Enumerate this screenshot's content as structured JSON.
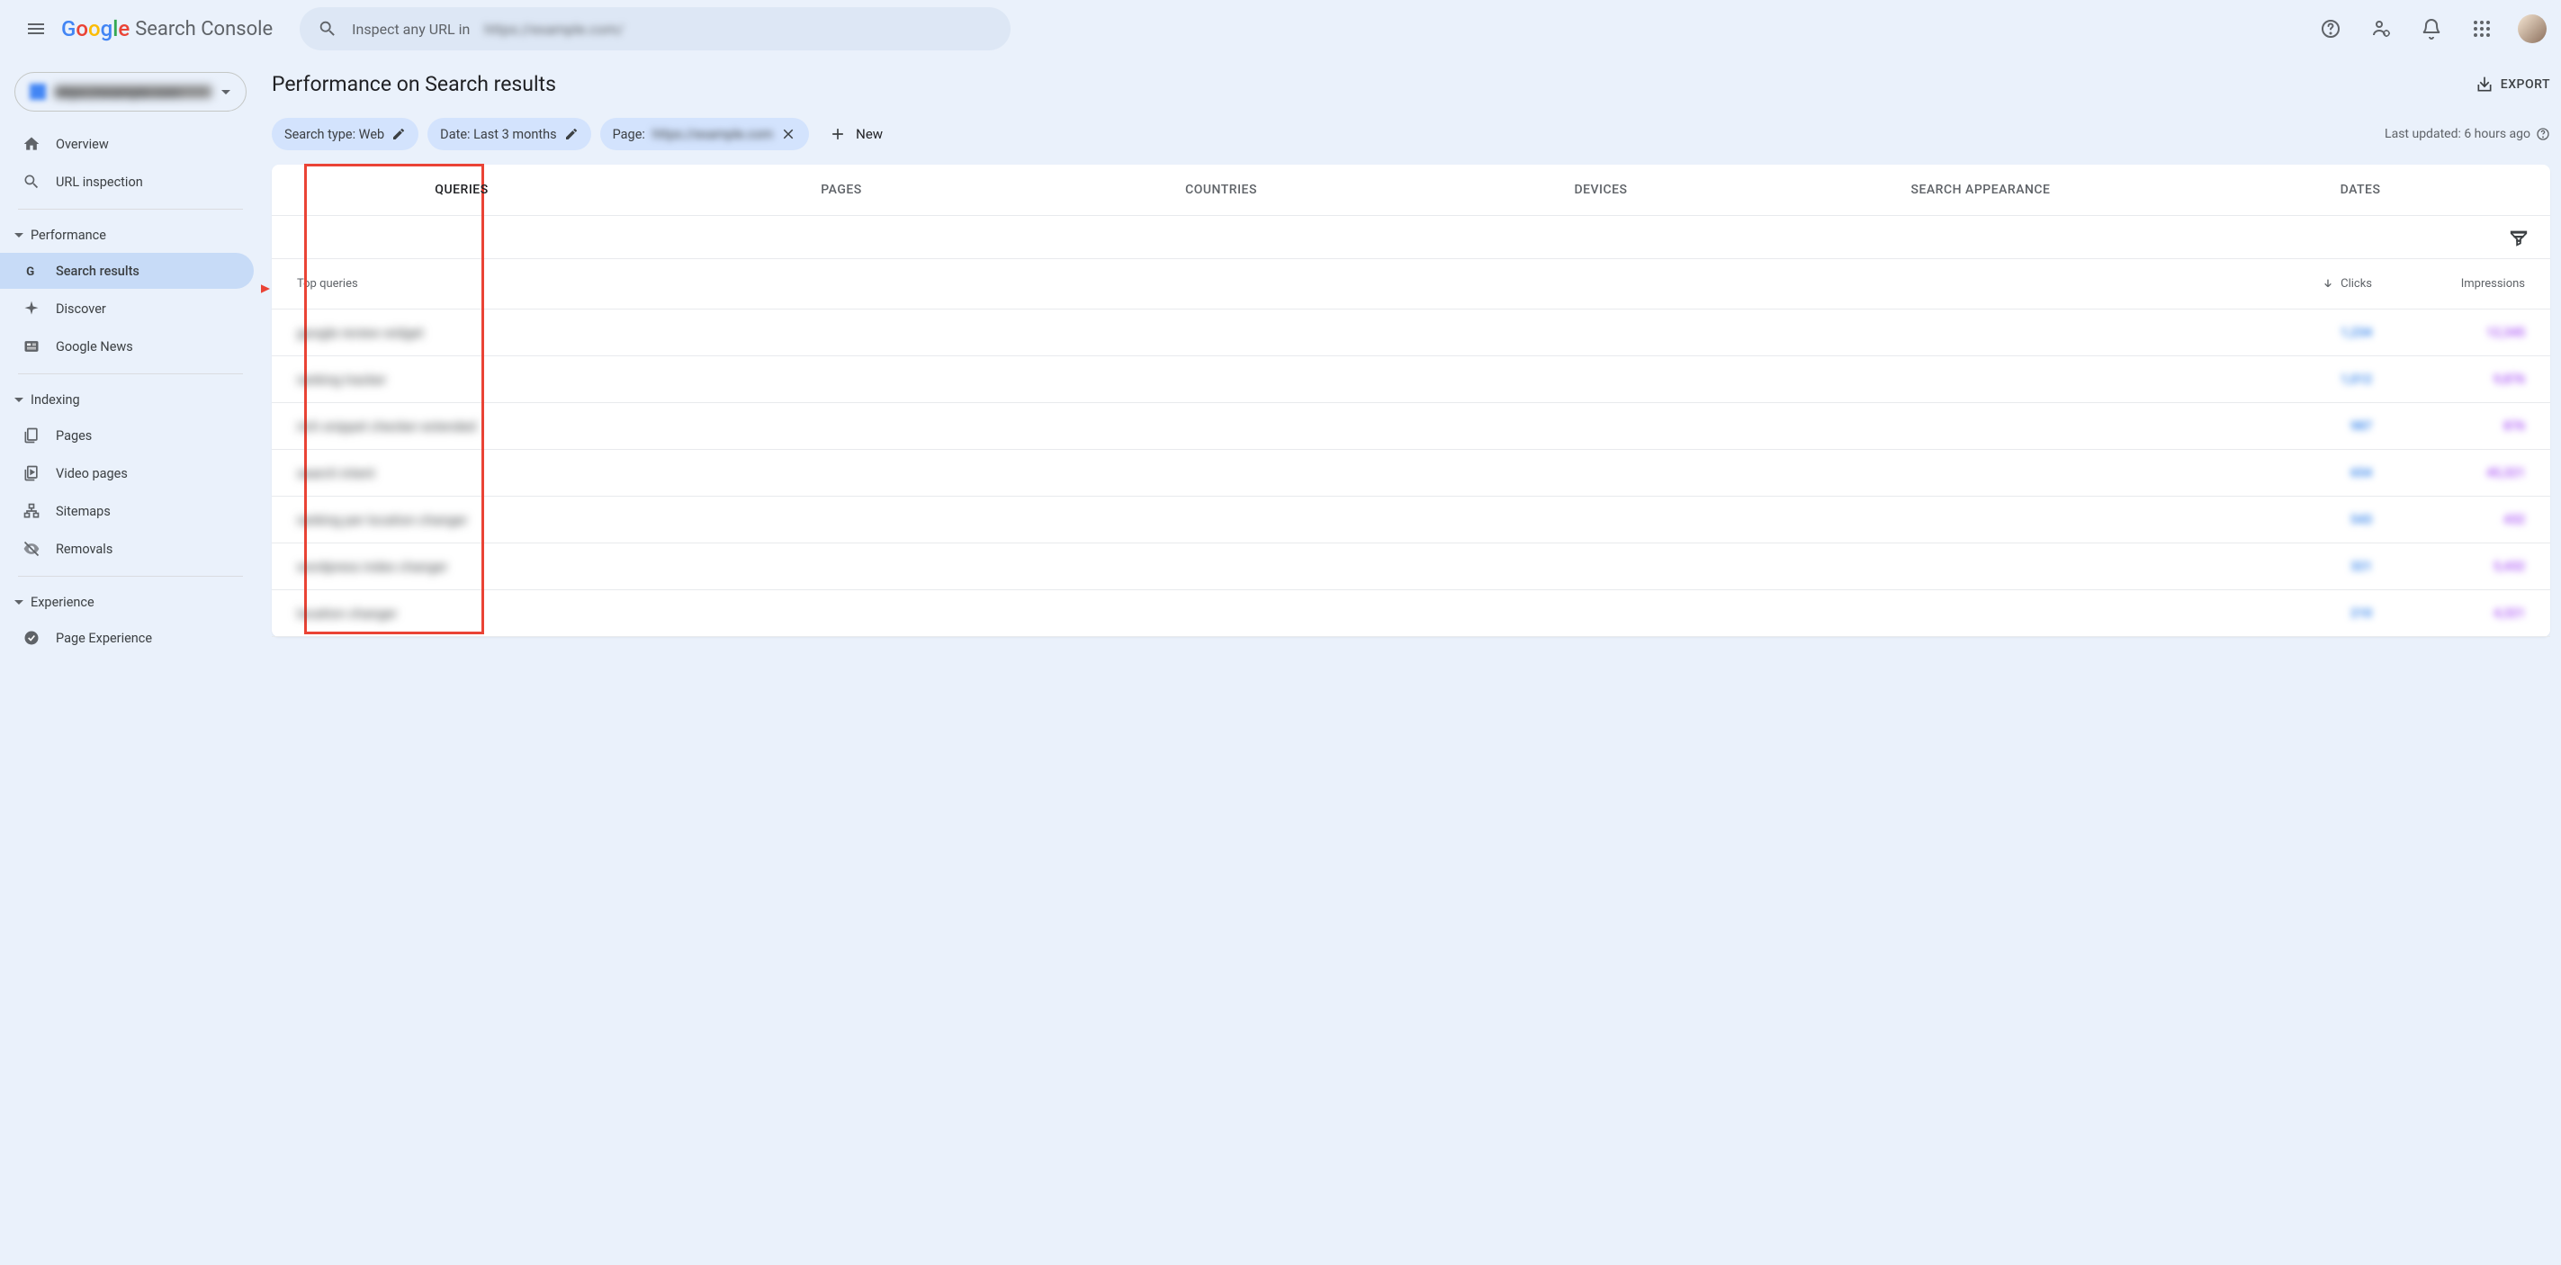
{
  "header": {
    "logo_suffix": "Search Console",
    "search_placeholder": "Inspect any URL in",
    "search_domain": "https://example.com/"
  },
  "property": {
    "name": "https://example.com"
  },
  "nav": {
    "overview": "Overview",
    "url_inspection": "URL inspection",
    "performance_section": "Performance",
    "search_results": "Search results",
    "discover": "Discover",
    "google_news": "Google News",
    "indexing_section": "Indexing",
    "pages": "Pages",
    "video_pages": "Video pages",
    "sitemaps": "Sitemaps",
    "removals": "Removals",
    "experience_section": "Experience",
    "page_experience": "Page Experience"
  },
  "main": {
    "title": "Performance on Search results",
    "export": "EXPORT",
    "last_updated": "Last updated: 6 hours ago"
  },
  "filters": {
    "search_type": "Search type: Web",
    "date": "Date: Last 3 months",
    "page_prefix": "Page:",
    "page_value": "https://example.com",
    "new": "New"
  },
  "tabs": {
    "queries": "Queries",
    "pages": "Pages",
    "countries": "Countries",
    "devices": "Devices",
    "search_appearance": "Search Appearance",
    "dates": "Dates"
  },
  "table": {
    "header_query": "Top queries",
    "header_clicks": "Clicks",
    "header_impressions": "Impressions",
    "rows": [
      {
        "query": "google review widget",
        "clicks": "1,234",
        "impressions": "12,345"
      },
      {
        "query": "ranking tracker",
        "clicks": "1,012",
        "impressions": "9,876"
      },
      {
        "query": "rich snippet checker extended",
        "clicks": "987",
        "impressions": "876"
      },
      {
        "query": "search intent",
        "clicks": "654",
        "impressions": "45,321"
      },
      {
        "query": "ranking per location changer",
        "clicks": "543",
        "impressions": "432"
      },
      {
        "query": "wordpress index changer",
        "clicks": "321",
        "impressions": "5,432"
      },
      {
        "query": "location changer",
        "clicks": "210",
        "impressions": "4,321"
      }
    ]
  }
}
